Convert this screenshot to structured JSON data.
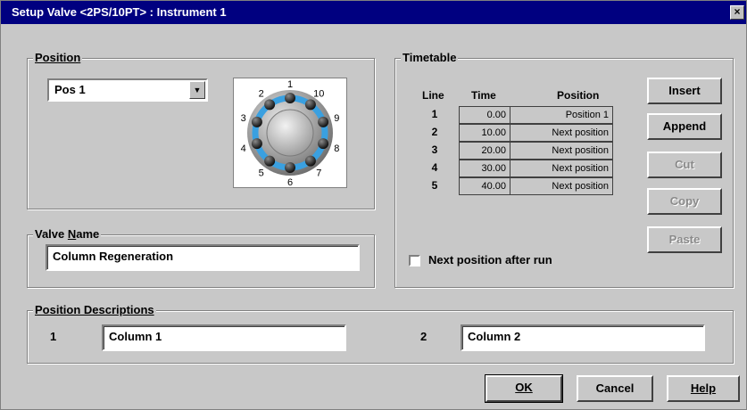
{
  "window": {
    "title": "Setup Valve <2PS/10PT> : Instrument 1",
    "close_glyph": "×"
  },
  "position_group": {
    "label": "Position",
    "selected": "Pos 1",
    "valve_numbers": [
      "1",
      "2",
      "3",
      "4",
      "5",
      "6",
      "7",
      "8",
      "9",
      "10"
    ]
  },
  "valve_name_group": {
    "label": "Valve Name",
    "value": "Column Regeneration"
  },
  "timetable": {
    "label": "Timetable",
    "headers": {
      "line": "Line",
      "time": "Time",
      "position": "Position"
    },
    "rows": [
      {
        "line": "1",
        "time": "0.00",
        "position": "Position 1"
      },
      {
        "line": "2",
        "time": "10.00",
        "position": "Next position"
      },
      {
        "line": "3",
        "time": "20.00",
        "position": "Next position"
      },
      {
        "line": "4",
        "time": "30.00",
        "position": "Next position"
      },
      {
        "line": "5",
        "time": "40.00",
        "position": "Next position"
      }
    ],
    "buttons": {
      "insert": "Insert",
      "append": "Append",
      "cut": "Cut",
      "copy": "Copy",
      "paste": "Paste"
    },
    "next_after_run_label": "Next position after run",
    "next_after_run_checked": false
  },
  "position_descriptions": {
    "label": "Position Descriptions",
    "items": [
      {
        "num": "1",
        "value": "Column 1"
      },
      {
        "num": "2",
        "value": "Column 2"
      }
    ]
  },
  "footer": {
    "ok": "OK",
    "cancel": "Cancel",
    "help": "Help"
  },
  "colors": {
    "titlebar": "#000080",
    "valve_accent": "#3aa0e0"
  }
}
